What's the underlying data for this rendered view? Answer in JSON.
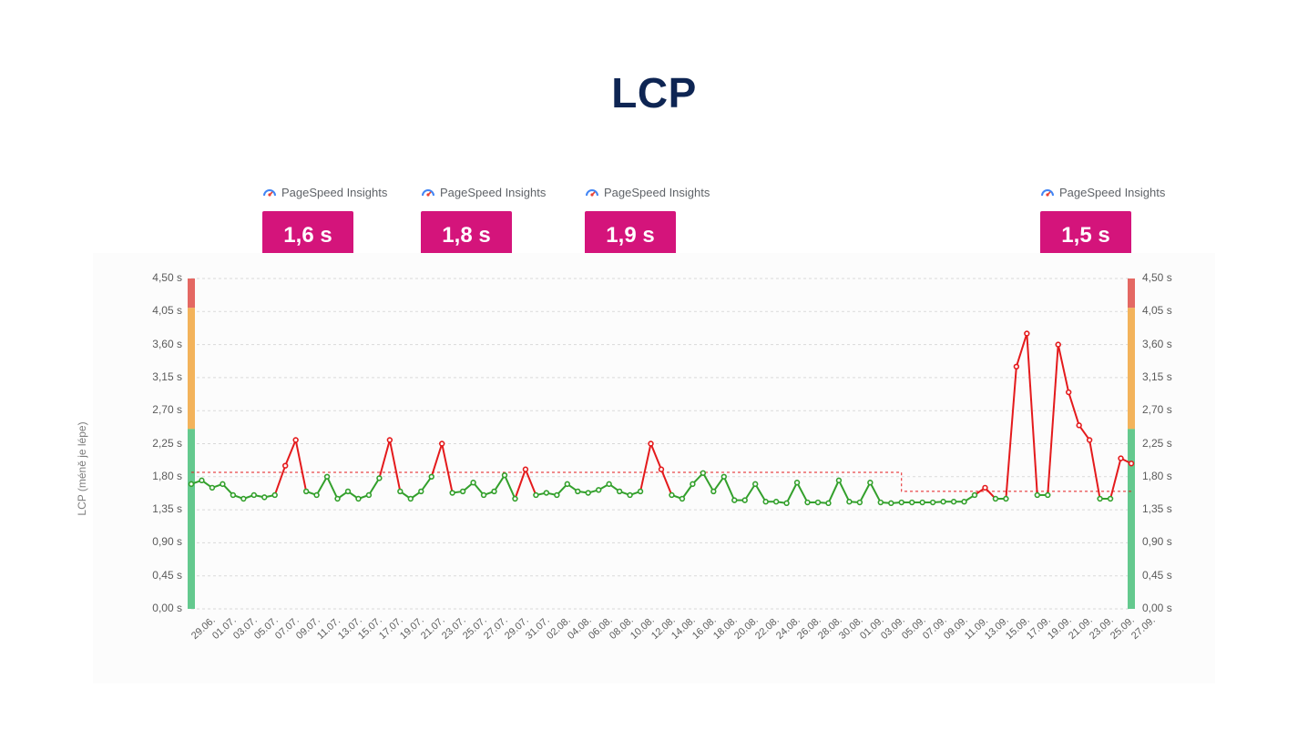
{
  "title": "LCP",
  "psi_label": "PageSpeed Insights",
  "callouts": [
    "1,6 s",
    "1,8 s",
    "1,9 s",
    "1,5 s"
  ],
  "yaxis_label": "LCP (méně je lépe)",
  "chart_data": {
    "type": "line",
    "title": "LCP",
    "xlabel": "",
    "ylabel": "LCP (méně je lépe)",
    "ylim": [
      0.0,
      4.5
    ],
    "y_ticks": [
      "0,00 s",
      "0,45 s",
      "0,90 s",
      "1,35 s",
      "1,80 s",
      "2,25 s",
      "2,70 s",
      "3,15 s",
      "3,60 s",
      "4,05 s",
      "4,50 s"
    ],
    "categories": [
      "29.06.",
      "01.07.",
      "03.07.",
      "05.07.",
      "07.07.",
      "09.07.",
      "11.07.",
      "13.07.",
      "15.07.",
      "17.07.",
      "19.07.",
      "21.07.",
      "23.07.",
      "25.07.",
      "27.07.",
      "29.07.",
      "31.07.",
      "02.08.",
      "04.08.",
      "06.08.",
      "08.08.",
      "10.08.",
      "12.08.",
      "14.08.",
      "16.08.",
      "18.08.",
      "20.08.",
      "22.08.",
      "24.08.",
      "26.08.",
      "28.08.",
      "30.08.",
      "01.09.",
      "03.09.",
      "05.09.",
      "07.09.",
      "09.09.",
      "11.09.",
      "13.09.",
      "15.09.",
      "17.09.",
      "19.09.",
      "21.09.",
      "23.09.",
      "25.09.",
      "27.09."
    ],
    "x_dates": [
      "29.06.",
      "30.06.",
      "01.07.",
      "02.07.",
      "03.07.",
      "04.07.",
      "05.07.",
      "06.07.",
      "07.07.",
      "08.07.",
      "09.07.",
      "10.07.",
      "11.07.",
      "12.07.",
      "13.07.",
      "14.07.",
      "15.07.",
      "16.07.",
      "17.07.",
      "18.07.",
      "19.07.",
      "20.07.",
      "21.07.",
      "22.07.",
      "23.07.",
      "24.07.",
      "25.07.",
      "26.07.",
      "27.07.",
      "28.07.",
      "29.07.",
      "30.07.",
      "31.07.",
      "01.08.",
      "02.08.",
      "03.08.",
      "04.08.",
      "05.08.",
      "06.08.",
      "07.08.",
      "08.08.",
      "09.08.",
      "10.08.",
      "11.08.",
      "12.08.",
      "13.08.",
      "14.08.",
      "15.08.",
      "16.08.",
      "17.08.",
      "18.08.",
      "19.08.",
      "20.08.",
      "21.08.",
      "22.08.",
      "23.08.",
      "24.08.",
      "25.08.",
      "26.08.",
      "27.08.",
      "28.08.",
      "29.08.",
      "30.08.",
      "31.08.",
      "01.09.",
      "02.09.",
      "03.09.",
      "04.09.",
      "05.09.",
      "06.09.",
      "07.09.",
      "08.09.",
      "09.09.",
      "10.09.",
      "11.09.",
      "12.09.",
      "13.09.",
      "14.09.",
      "15.09.",
      "16.09.",
      "17.09.",
      "18.09.",
      "19.09.",
      "20.09.",
      "21.09.",
      "22.09.",
      "23.09.",
      "24.09.",
      "25.09.",
      "26.09.",
      "27.09."
    ],
    "values": [
      1.7,
      1.75,
      1.65,
      1.7,
      1.55,
      1.5,
      1.55,
      1.52,
      1.55,
      1.95,
      2.3,
      1.6,
      1.55,
      1.8,
      1.5,
      1.6,
      1.5,
      1.55,
      1.78,
      2.3,
      1.6,
      1.5,
      1.6,
      1.8,
      2.25,
      1.58,
      1.6,
      1.72,
      1.55,
      1.6,
      1.82,
      1.5,
      1.9,
      1.55,
      1.58,
      1.55,
      1.7,
      1.6,
      1.58,
      1.62,
      1.7,
      1.6,
      1.55,
      1.6,
      2.25,
      1.9,
      1.55,
      1.5,
      1.7,
      1.85,
      1.6,
      1.8,
      1.48,
      1.48,
      1.7,
      1.46,
      1.46,
      1.44,
      1.72,
      1.45,
      1.45,
      1.44,
      1.75,
      1.46,
      1.45,
      1.72,
      1.45,
      1.44,
      1.45,
      1.45,
      1.45,
      1.45,
      1.46,
      1.46,
      1.46,
      1.55,
      1.65,
      1.5,
      1.5,
      3.3,
      3.75,
      1.55,
      1.55,
      3.6,
      2.95,
      2.5,
      2.3,
      1.5,
      1.5,
      2.05,
      1.98
    ],
    "threshold_line": {
      "segments": [
        {
          "x_from": "29.06.",
          "x_to": "05.09.",
          "value": 1.86
        },
        {
          "x_from": "05.09.",
          "x_to": "27.09.",
          "value": 1.6
        }
      ]
    },
    "thresholds": {
      "good_max": 2.45,
      "warn_max": 4.1
    },
    "colors": {
      "good": "#64c98e",
      "warn": "#f3b35b",
      "bad": "#e46863",
      "marker_good": "#33a02c",
      "marker_bad": "#e41a1c",
      "accent": "#d4147b"
    },
    "callouts": [
      {
        "x": "11.07.",
        "label": "1,6 s"
      },
      {
        "x": "25.07.",
        "label": "1,8 s"
      },
      {
        "x": "08.08.",
        "label": "1,9 s"
      },
      {
        "x": "22.09.",
        "label": "1,5 s"
      }
    ]
  }
}
